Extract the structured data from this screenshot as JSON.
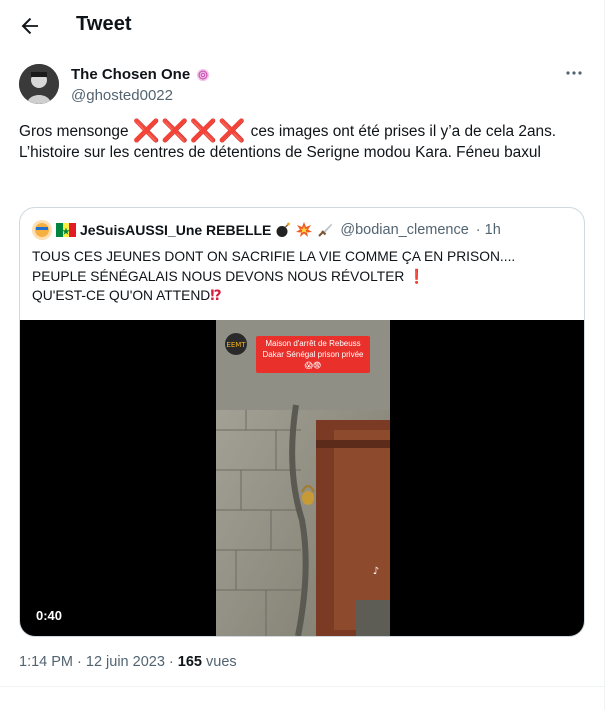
{
  "header": {
    "title": "Tweet"
  },
  "tweet": {
    "author_name": "The Chosen One",
    "author_handle": "@ghosted0022",
    "text_part1": "Gros mensonge ",
    "text_part2": " ces images ont été prises il y’a de cela 2ans. L’histoire sur les centres de détentions de Serigne modou Kara. Féneu baxul",
    "marks": "❌❌❌❌",
    "time": "1:14 PM",
    "date": "12 juin 2023",
    "separator": " · ",
    "views_count": "165",
    "views_label": " vues"
  },
  "quote": {
    "author_name": "JeSuisAUSSI_Une REBELLE",
    "author_handle": "@bodian_clemence",
    "age": "· 1h",
    "line1": "TOUS CES JEUNES DONT ON SACRIFIE LA VIE COMME ÇA EN PRISON....",
    "line2": "PEUPLE SÉNÉGALAIS NOUS DEVONS NOUS RÉVOLTER",
    "line2_mark": "❗",
    "line3": "QU'EST-CE QU'ON ATTEND",
    "line3_mark": "⁉",
    "video": {
      "duration": "0:40",
      "caption": "Maison d'arrêt de Rebeuss Dakar Sénégal prison privée 😱😨"
    }
  },
  "icons": {
    "back": "arrow-left-icon",
    "more": "more-horizontal-icon"
  },
  "colors": {
    "text": "#0f1419",
    "secondary": "#536471",
    "border": "#cfd9de",
    "red": "#d21d3d"
  }
}
